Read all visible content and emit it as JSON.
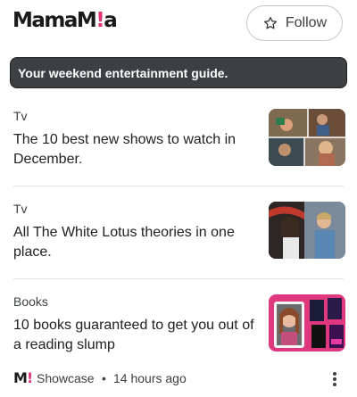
{
  "publisher": {
    "logo_text_main": "MamaM",
    "logo_text_accent": "!",
    "logo_text_end": "a"
  },
  "follow_button": {
    "label": "Follow",
    "icon": "star-outline-icon"
  },
  "banner": {
    "text": "Your weekend entertainment guide."
  },
  "articles": [
    {
      "category": "Tv",
      "headline": "The 10 best new shows to watch in December."
    },
    {
      "category": "Tv",
      "headline": "All The White Lotus theories in one place."
    },
    {
      "category": "Books",
      "headline": "10 books guaranteed to get you out of a reading slump"
    }
  ],
  "footer": {
    "logo_main": "M",
    "logo_accent": "!",
    "source": "Showcase",
    "separator": "•",
    "time": "14 hours ago",
    "more_icon": "more-vert-icon"
  },
  "colors": {
    "accent": "#e0337a",
    "banner_bg": "#3c4043",
    "books_thumb_bg": "#e0387f"
  }
}
